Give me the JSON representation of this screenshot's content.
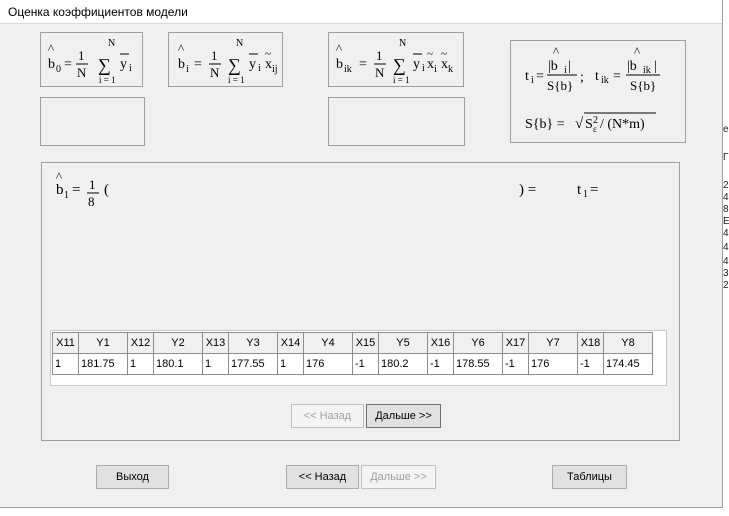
{
  "window": {
    "title": "Оценка коэффициентов модели"
  },
  "formulas": {
    "b0": {
      "lhs": "b",
      "sub": "0",
      "frac_num": "1",
      "frac_den": "N",
      "sum_top": "N",
      "sum_bot": "i = 1",
      "term": "y",
      "term_sub": "i"
    },
    "bi": {
      "lhs": "b",
      "sub": "i",
      "frac_num": "1",
      "frac_den": "N",
      "sum_top": "N",
      "sum_bot": "i = 1",
      "term": "y",
      "term_sub": "i",
      "x": "x",
      "x_sub": "ij"
    },
    "bik": {
      "lhs": "b",
      "sub": "ik",
      "frac_num": "1",
      "frac_den": "N",
      "sum_top": "N",
      "sum_bot": "i = 1",
      "term": "y",
      "term_sub": "i",
      "x1": "x",
      "x1_sub": "i",
      "x2": "x",
      "x2_sub": "k"
    },
    "t": {
      "t1": "t",
      "t1_sub": "i",
      "num1": "|b",
      "num1_sub": "i",
      "den": "S{b}",
      "sep": ";",
      "t2": "t",
      "t2_sub": "ik",
      "num2": "|b",
      "num2_sub": "ik",
      "sb_lhs": "S{b} =",
      "sb_rhs": "/ (N*m)",
      "s_sub": "ε",
      "s_sup": "2",
      "s": "S"
    }
  },
  "calc": {
    "lhs": "b",
    "lhs_sub": "1",
    "eq": "=",
    "frac_num": "1",
    "frac_den": "8",
    "open": "(",
    "close": ") =",
    "t": "t",
    "t_sub": "1",
    "t_eq": "="
  },
  "table": {
    "headers": [
      "X11",
      "Y1",
      "X12",
      "Y2",
      "X13",
      "Y3",
      "X14",
      "Y4",
      "X15",
      "Y5",
      "X16",
      "Y6",
      "X17",
      "Y7",
      "X18",
      "Y8"
    ],
    "rows": [
      [
        "1",
        "181.75",
        "1",
        "180.1",
        "1",
        "177.55",
        "1",
        "176",
        "-1",
        "180.2",
        "-1",
        "178.55",
        "-1",
        "176",
        "-1",
        "174.45"
      ]
    ]
  },
  "inner_nav": {
    "back": "<< Назад",
    "next": "Дальше >>"
  },
  "bottom_nav": {
    "exit": "Выход",
    "back": "<< Назад",
    "next": "Дальше >>",
    "tables": "Таблицы"
  },
  "right_strip": [
    "е",
    "Г",
    "2",
    "4",
    "8",
    "Е",
    "4",
    "4",
    "4",
    "3",
    "2"
  ]
}
